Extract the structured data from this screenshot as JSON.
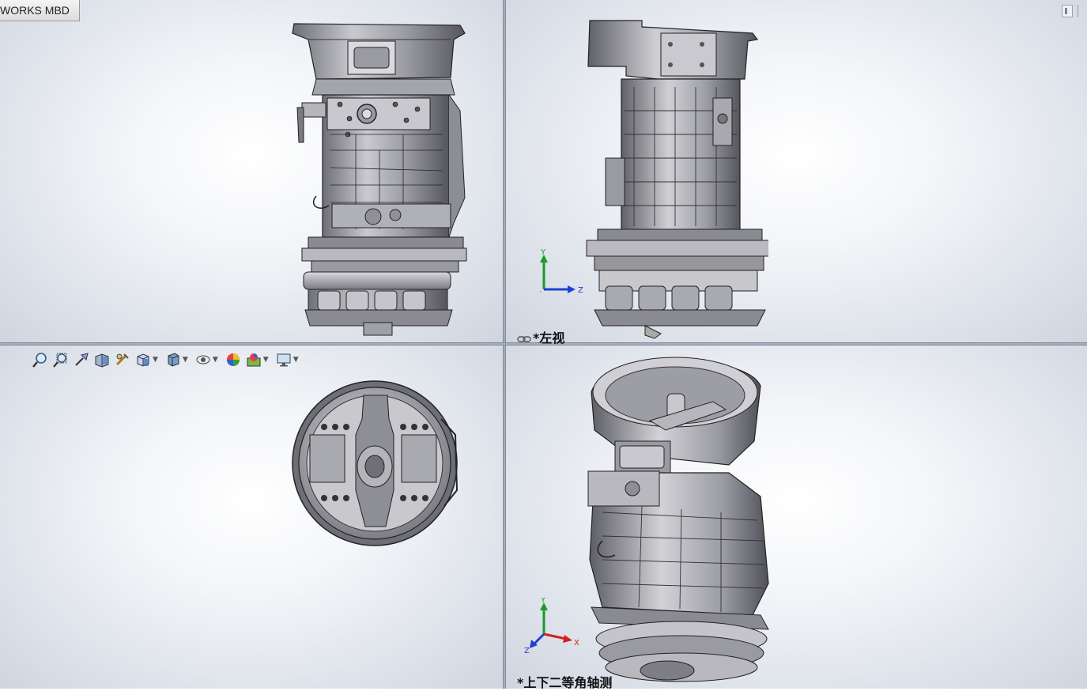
{
  "app": {
    "title": "WORKS MBD"
  },
  "viewports": {
    "top_left": {
      "label": ""
    },
    "top_right": {
      "label": "*左视",
      "label_icon": "link-chain-icon"
    },
    "bottom_left": {
      "label": ""
    },
    "bottom_right": {
      "label": "*上下二等角轴测"
    }
  },
  "triad": {
    "x_label": "X",
    "y_label": "Y",
    "z_label": "Z"
  },
  "toolbar": {
    "items": [
      "zoom-to-fit-icon",
      "zoom-to-area-icon",
      "previous-view-icon",
      "section-view-icon",
      "dynamic-annotation-views-icon",
      "view-orientation-icon",
      "display-style-icon",
      "hide-show-items-icon",
      "edit-appearance-icon",
      "apply-scene-icon",
      "view-settings-icon"
    ]
  },
  "colors": {
    "viewport_center": "#ffffff",
    "viewport_edge": "#cfd5df",
    "divider": "#8c96a6",
    "axis_x": "#d02020",
    "axis_y": "#1a9a2a",
    "axis_z": "#2040d0"
  }
}
